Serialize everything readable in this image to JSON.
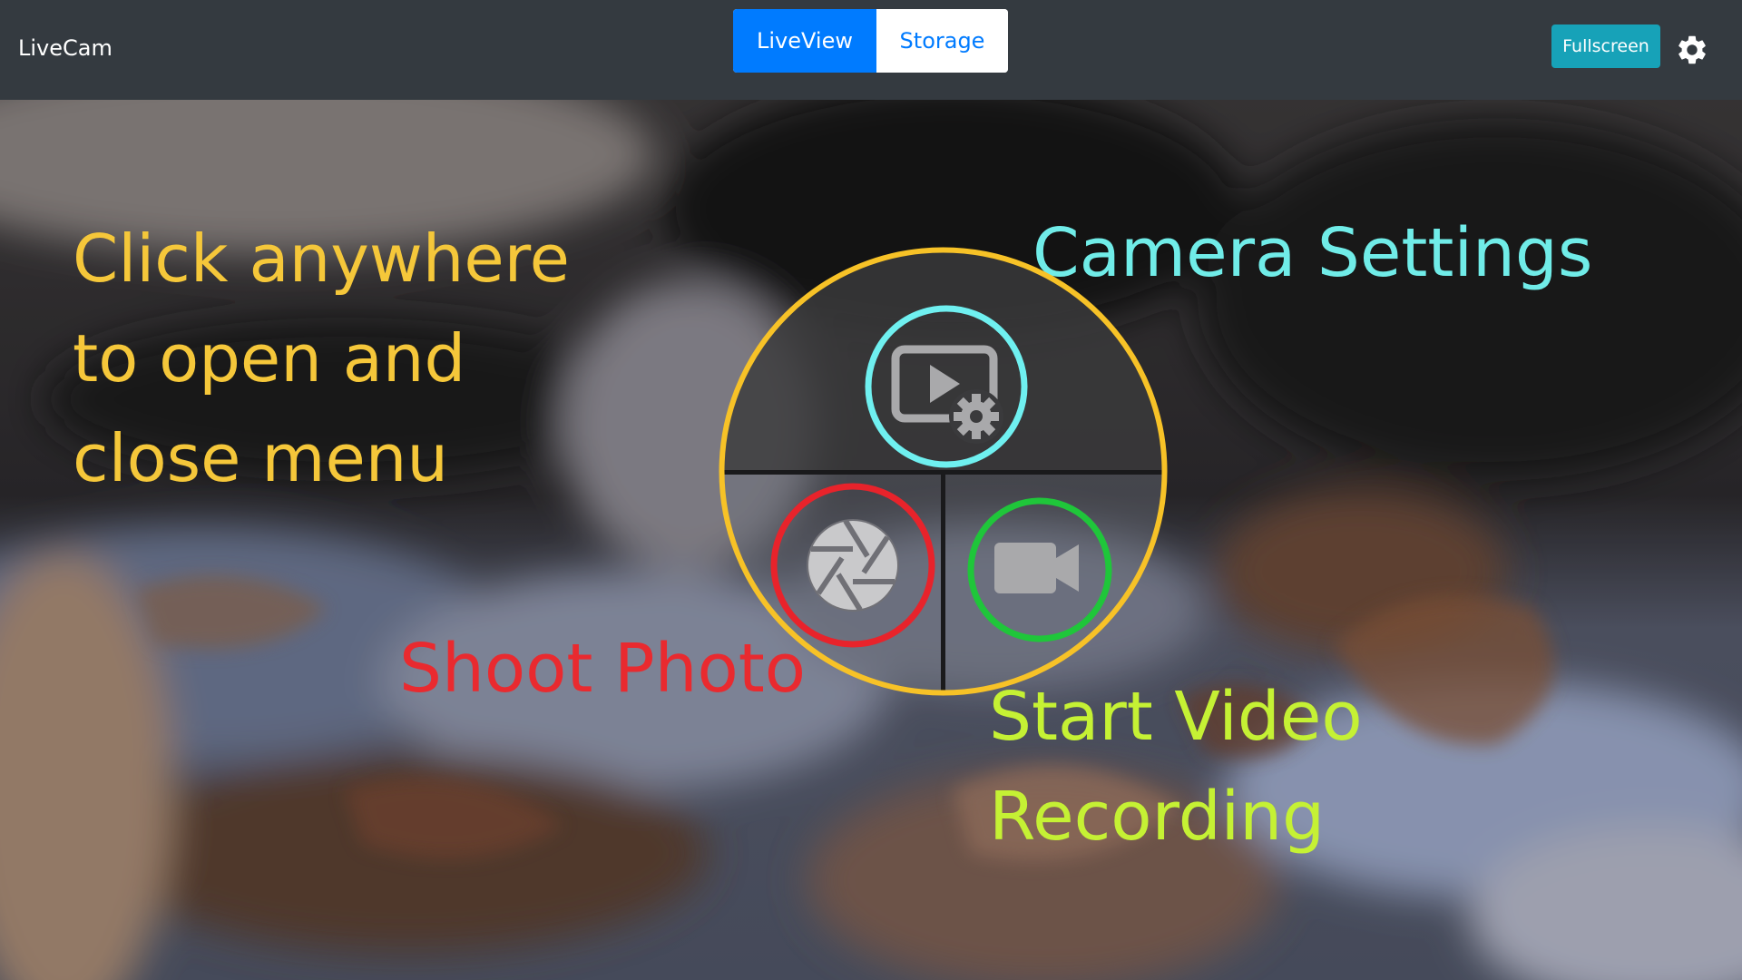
{
  "app": {
    "title": "LiveCam"
  },
  "tabs": [
    {
      "label": "LiveView",
      "active": true
    },
    {
      "label": "Storage",
      "active": false
    }
  ],
  "header": {
    "fullscreen_label": "Fullscreen",
    "settings_icon": "gear-icon"
  },
  "menu": {
    "items": [
      {
        "name": "camera-settings",
        "icon": "video-settings-icon"
      },
      {
        "name": "shoot-photo",
        "icon": "aperture-icon"
      },
      {
        "name": "start-video",
        "icon": "video-camera-icon"
      }
    ]
  },
  "annotations": {
    "click_line1": "Click anywhere",
    "click_line2": "to open and",
    "click_line3": "close menu",
    "camera_settings": "Camera Settings",
    "shoot_photo": "Shoot Photo",
    "video_line1": "Start Video",
    "video_line2": "Recording"
  },
  "colors": {
    "navbar": "#343a40",
    "primary": "#007bff",
    "info": "#17a2b8",
    "menu_ring": "#f7c227",
    "camera_ring": "#6ff0f0",
    "photo_ring": "#e8232b",
    "video_ring": "#1fc63a"
  }
}
